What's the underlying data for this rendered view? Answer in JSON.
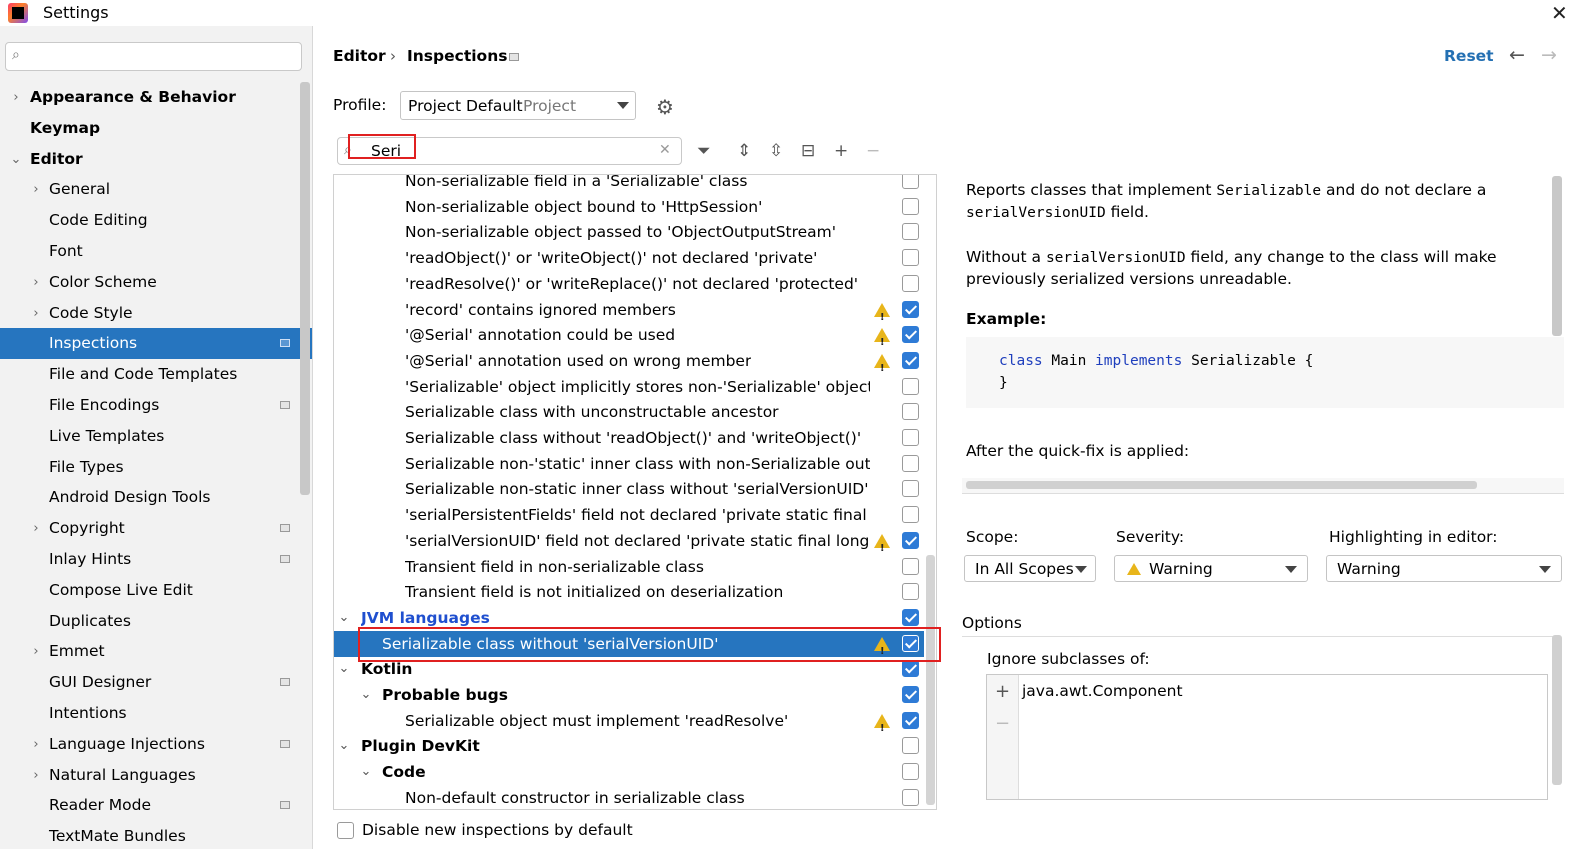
{
  "window": {
    "title": "Settings"
  },
  "sidebar": {
    "search_placeholder": "",
    "items": [
      {
        "label": "Appearance & Behavior",
        "level": 0,
        "expandable": true,
        "expanded": false,
        "bold": true,
        "project": false,
        "selected": false
      },
      {
        "label": "Keymap",
        "level": 0,
        "expandable": false,
        "bold": true,
        "project": false,
        "selected": false
      },
      {
        "label": "Editor",
        "level": 0,
        "expandable": true,
        "expanded": true,
        "bold": true,
        "project": false,
        "selected": false
      },
      {
        "label": "General",
        "level": 1,
        "expandable": true,
        "expanded": false,
        "project": false,
        "selected": false
      },
      {
        "label": "Code Editing",
        "level": 1,
        "expandable": false,
        "project": false,
        "selected": false
      },
      {
        "label": "Font",
        "level": 1,
        "expandable": false,
        "project": false,
        "selected": false
      },
      {
        "label": "Color Scheme",
        "level": 1,
        "expandable": true,
        "expanded": false,
        "project": false,
        "selected": false
      },
      {
        "label": "Code Style",
        "level": 1,
        "expandable": true,
        "expanded": false,
        "project": false,
        "selected": false
      },
      {
        "label": "Inspections",
        "level": 1,
        "expandable": false,
        "project": true,
        "selected": true
      },
      {
        "label": "File and Code Templates",
        "level": 1,
        "expandable": false,
        "project": false,
        "selected": false
      },
      {
        "label": "File Encodings",
        "level": 1,
        "expandable": false,
        "project": true,
        "selected": false
      },
      {
        "label": "Live Templates",
        "level": 1,
        "expandable": false,
        "project": false,
        "selected": false
      },
      {
        "label": "File Types",
        "level": 1,
        "expandable": false,
        "project": false,
        "selected": false
      },
      {
        "label": "Android Design Tools",
        "level": 1,
        "expandable": false,
        "project": false,
        "selected": false
      },
      {
        "label": "Copyright",
        "level": 1,
        "expandable": true,
        "expanded": false,
        "project": true,
        "selected": false
      },
      {
        "label": "Inlay Hints",
        "level": 1,
        "expandable": false,
        "project": true,
        "selected": false
      },
      {
        "label": "Compose Live Edit",
        "level": 1,
        "expandable": false,
        "project": false,
        "selected": false
      },
      {
        "label": "Duplicates",
        "level": 1,
        "expandable": false,
        "project": false,
        "selected": false
      },
      {
        "label": "Emmet",
        "level": 1,
        "expandable": true,
        "expanded": false,
        "project": false,
        "selected": false
      },
      {
        "label": "GUI Designer",
        "level": 1,
        "expandable": false,
        "project": true,
        "selected": false
      },
      {
        "label": "Intentions",
        "level": 1,
        "expandable": false,
        "project": false,
        "selected": false
      },
      {
        "label": "Language Injections",
        "level": 1,
        "expandable": true,
        "expanded": false,
        "project": true,
        "selected": false
      },
      {
        "label": "Natural Languages",
        "level": 1,
        "expandable": true,
        "expanded": false,
        "project": false,
        "selected": false
      },
      {
        "label": "Reader Mode",
        "level": 1,
        "expandable": false,
        "project": true,
        "selected": false
      },
      {
        "label": "TextMate Bundles",
        "level": 1,
        "expandable": false,
        "project": false,
        "selected": false
      }
    ]
  },
  "header": {
    "breadcrumb": [
      "Editor",
      "Inspections"
    ],
    "breadcrumb_separator": "›",
    "reset_label": "Reset"
  },
  "profile": {
    "label": "Profile:",
    "name": "Project Default",
    "kind": "Project"
  },
  "search": {
    "value": "Seri",
    "placeholder": ""
  },
  "inspections": [
    {
      "label": "Non-serializable field in a 'Serializable' class",
      "level": 3,
      "warn": false,
      "checked": false
    },
    {
      "label": "Non-serializable object bound to 'HttpSession'",
      "level": 3,
      "warn": false,
      "checked": false
    },
    {
      "label": "Non-serializable object passed to 'ObjectOutputStream'",
      "level": 3,
      "warn": false,
      "checked": false
    },
    {
      "label": "'readObject()' or 'writeObject()' not declared 'private'",
      "level": 3,
      "warn": false,
      "checked": false
    },
    {
      "label": "'readResolve()' or 'writeReplace()' not declared 'protected'",
      "level": 3,
      "warn": false,
      "checked": false
    },
    {
      "label": "'record' contains ignored members",
      "level": 3,
      "warn": true,
      "checked": true
    },
    {
      "label": "'@Serial' annotation could be used",
      "level": 3,
      "warn": true,
      "checked": true
    },
    {
      "label": "'@Serial' annotation used on wrong member",
      "level": 3,
      "warn": true,
      "checked": true
    },
    {
      "label": "'Serializable' object implicitly stores non-'Serializable' object",
      "level": 3,
      "warn": false,
      "checked": false
    },
    {
      "label": "Serializable class with unconstructable ancestor",
      "level": 3,
      "warn": false,
      "checked": false
    },
    {
      "label": "Serializable class without 'readObject()' and 'writeObject()'",
      "level": 3,
      "warn": false,
      "checked": false
    },
    {
      "label": "Serializable non-'static' inner class with non-Serializable outer clas",
      "level": 3,
      "warn": false,
      "checked": false
    },
    {
      "label": "Serializable non-static inner class without 'serialVersionUID'",
      "level": 3,
      "warn": false,
      "checked": false
    },
    {
      "label": "'serialPersistentFields' field not declared 'private static final Objec",
      "level": 3,
      "warn": false,
      "checked": false
    },
    {
      "label": "'serialVersionUID' field not declared 'private static final long'",
      "level": 3,
      "warn": true,
      "checked": true
    },
    {
      "label": "Transient field in non-serializable class",
      "level": 3,
      "warn": false,
      "checked": false
    },
    {
      "label": "Transient field is not initialized on deserialization",
      "level": 3,
      "warn": false,
      "checked": false
    },
    {
      "label": "JVM languages",
      "level": 1,
      "group": true,
      "blue": true,
      "expanded": true,
      "warn": false,
      "checked": true
    },
    {
      "label": "Serializable class without 'serialVersionUID'",
      "level": 2,
      "warn": true,
      "checked": true,
      "selected": true
    },
    {
      "label": "Kotlin",
      "level": 1,
      "group": true,
      "expanded": true,
      "warn": false,
      "checked": true
    },
    {
      "label": "Probable bugs",
      "level": 2,
      "group": true,
      "expanded": true,
      "warn": false,
      "checked": true
    },
    {
      "label": "Serializable object must implement 'readResolve'",
      "level": 3,
      "warn": true,
      "checked": true
    },
    {
      "label": "Plugin DevKit",
      "level": 1,
      "group": true,
      "expanded": true,
      "warn": false,
      "checked": false
    },
    {
      "label": "Code",
      "level": 2,
      "group": true,
      "expanded": true,
      "warn": false,
      "checked": false
    },
    {
      "label": "Non-default constructor in serializable class",
      "level": 3,
      "warn": false,
      "checked": false
    }
  ],
  "disable_new": {
    "label": "Disable new inspections by default",
    "checked": false
  },
  "description": {
    "p1_a": "Reports classes that implement ",
    "p1_code1": "Serializable",
    "p1_b": " and do not declare a",
    "p1_code2": "serialVersionUID",
    "p1_c": " field.",
    "p2_a": "Without a ",
    "p2_code": "serialVersionUID",
    "p2_b": " field, any change to the class will make previously serialized versions unreadable.",
    "example_title": "Example:",
    "code_kw1": "class",
    "code_name": " Main ",
    "code_kw2": "implements",
    "code_rest": " Serializable {",
    "code_close": "}",
    "after_fix": "After the quick-fix is applied:"
  },
  "settings": {
    "scope_label": "Scope:",
    "scope_value": "In All Scopes",
    "severity_label": "Severity:",
    "severity_value": "Warning",
    "highlight_label": "Highlighting in editor:",
    "highlight_value": "Warning"
  },
  "options": {
    "title": "Options",
    "ignore_label": "Ignore subclasses of:",
    "items": [
      "java.awt.Component"
    ]
  },
  "colors": {
    "accent": "#2675bf",
    "warning": "#e8b51a",
    "link": "#2470b3",
    "group_blue": "#1f4fcf",
    "annotation_red": "#e02020"
  }
}
